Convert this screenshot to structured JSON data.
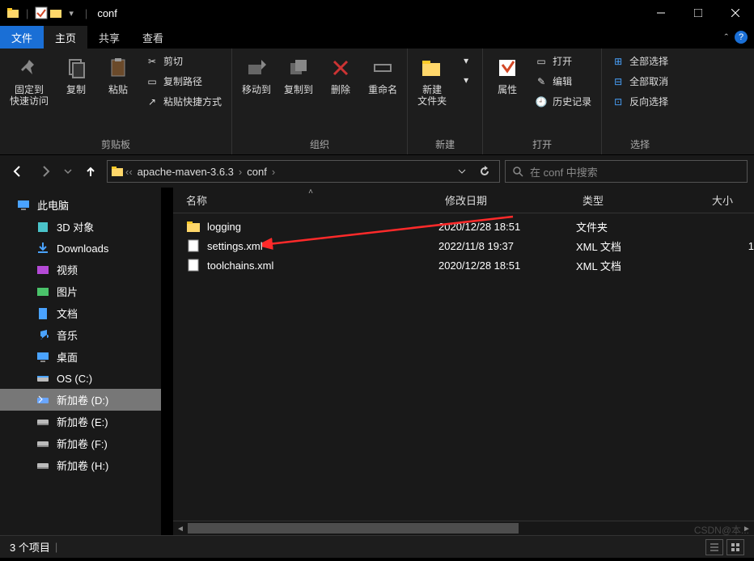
{
  "title": "conf",
  "tabs": {
    "file": "文件",
    "home": "主页",
    "share": "共享",
    "view": "查看"
  },
  "ribbon": {
    "pin": "固定到\n快速访问",
    "copy": "复制",
    "paste": "粘贴",
    "cut": "剪切",
    "copypath": "复制路径",
    "pasteshort": "粘贴快捷方式",
    "group_clip": "剪贴板",
    "moveto": "移动到",
    "copyto": "复制到",
    "delete": "删除",
    "rename": "重命名",
    "group_org": "组织",
    "newfolder": "新建\n文件夹",
    "group_new": "新建",
    "props": "属性",
    "open": "打开",
    "edit": "编辑",
    "history": "历史记录",
    "group_open": "打开",
    "selectall": "全部选择",
    "selectnone": "全部取消",
    "selectinv": "反向选择",
    "group_select": "选择"
  },
  "breadcrumb": {
    "seg1": "apache-maven-3.6.3",
    "seg2": "conf"
  },
  "search_placeholder": "在 conf 中搜索",
  "sidebar": {
    "root": "此电脑",
    "items": [
      {
        "label": "3D 对象"
      },
      {
        "label": "Downloads"
      },
      {
        "label": "视频"
      },
      {
        "label": "图片"
      },
      {
        "label": "文档"
      },
      {
        "label": "音乐"
      },
      {
        "label": "桌面"
      },
      {
        "label": "OS (C:)"
      },
      {
        "label": "新加卷 (D:)",
        "selected": true
      },
      {
        "label": "新加卷 (E:)"
      },
      {
        "label": "新加卷 (F:)"
      },
      {
        "label": "新加卷 (H:)"
      }
    ]
  },
  "columns": {
    "name": "名称",
    "date": "修改日期",
    "type": "类型",
    "size": "大小"
  },
  "files": [
    {
      "name": "logging",
      "date": "2020/12/28 18:51",
      "type": "文件夹",
      "size": "",
      "icon": "folder"
    },
    {
      "name": "settings.xml",
      "date": "2022/11/8 19:37",
      "type": "XML 文档",
      "size": "1",
      "icon": "file"
    },
    {
      "name": "toolchains.xml",
      "date": "2020/12/28 18:51",
      "type": "XML 文档",
      "size": "",
      "icon": "file"
    }
  ],
  "status": "3 个项目",
  "watermark": "CSDN@本..."
}
